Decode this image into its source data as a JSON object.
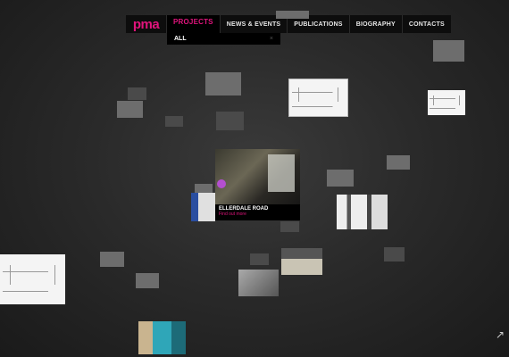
{
  "brand": {
    "logo_text": "pma",
    "accent": "#e0147c"
  },
  "nav": {
    "items": [
      {
        "label": "PROJECTS",
        "active": true
      },
      {
        "label": "NEWS & EVENTS",
        "active": false
      },
      {
        "label": "PUBLICATIONS",
        "active": false
      },
      {
        "label": "BIOGRAPHY",
        "active": false
      },
      {
        "label": "CONTACTS",
        "active": false
      }
    ]
  },
  "filter": {
    "selected": "ALL",
    "close_icon": "close-icon"
  },
  "featured": {
    "name": "ELLERDALE ROAD",
    "subtitle": "Find out more"
  },
  "corner_icon": "expand-icon"
}
